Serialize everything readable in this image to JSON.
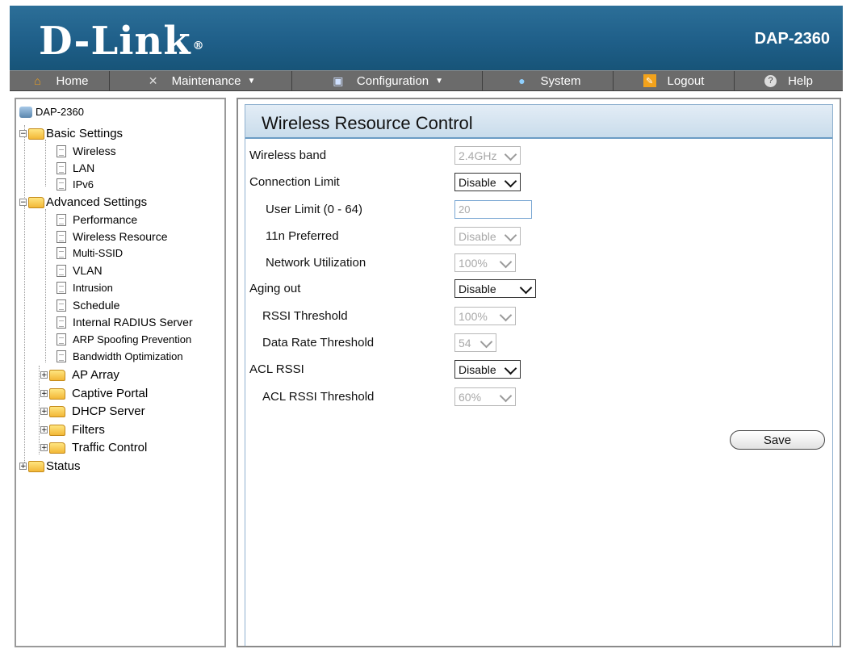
{
  "header": {
    "logo": "D-Link",
    "logo_mark": "®",
    "model": "DAP-2360"
  },
  "nav": [
    {
      "label": "Home",
      "icon": "home-icon",
      "dropdown": false
    },
    {
      "label": "Maintenance",
      "icon": "tools-icon",
      "dropdown": true
    },
    {
      "label": "Configuration",
      "icon": "disk-icon",
      "dropdown": true
    },
    {
      "label": "System",
      "icon": "system-icon",
      "dropdown": false
    },
    {
      "label": "Logout",
      "icon": "logout-icon",
      "dropdown": false
    },
    {
      "label": "Help",
      "icon": "help-icon",
      "dropdown": false
    }
  ],
  "tree": {
    "root": "DAP-2360",
    "basic": {
      "label": "Basic Settings",
      "items": [
        "Wireless",
        "LAN",
        "IPv6"
      ]
    },
    "advanced": {
      "label": "Advanced Settings",
      "items": [
        "Performance",
        "Wireless Resource",
        "Multi-SSID",
        "VLAN",
        "Intrusion",
        "Schedule",
        "Internal RADIUS Server",
        "ARP Spoofing Prevention",
        "Bandwidth Optimization"
      ]
    },
    "advanced_folders": [
      "AP Array",
      "Captive Portal",
      "DHCP Server",
      "Filters",
      "Traffic Control"
    ],
    "status": "Status"
  },
  "content": {
    "title": "Wireless Resource Control",
    "fields": {
      "wireless_band": {
        "label": "Wireless band",
        "value": "2.4GHz",
        "disabled": true
      },
      "connection_limit": {
        "label": "Connection Limit",
        "value": "Disable",
        "disabled": false
      },
      "user_limit": {
        "label": "User Limit (0 - 64)",
        "value": "20",
        "disabled": true
      },
      "n_preferred": {
        "label": "11n Preferred",
        "value": "Disable",
        "disabled": true
      },
      "network_utilization": {
        "label": "Network Utilization",
        "value": "100%",
        "disabled": true
      },
      "aging_out": {
        "label": "Aging out",
        "value": "Disable",
        "disabled": false
      },
      "rssi_threshold": {
        "label": "RSSI Threshold",
        "value": "100%",
        "disabled": true
      },
      "data_rate_threshold": {
        "label": "Data Rate Threshold",
        "value": "54",
        "disabled": true
      },
      "acl_rssi": {
        "label": "ACL RSSI",
        "value": "Disable",
        "disabled": false
      },
      "acl_rssi_threshold": {
        "label": "ACL RSSI Threshold",
        "value": "60%",
        "disabled": true
      }
    },
    "save_label": "Save"
  },
  "colors": {
    "header": "#1f5f89",
    "nav": "#6b6b6b",
    "title_bar": "#c9dceb",
    "accent": "#6b9cc4"
  }
}
